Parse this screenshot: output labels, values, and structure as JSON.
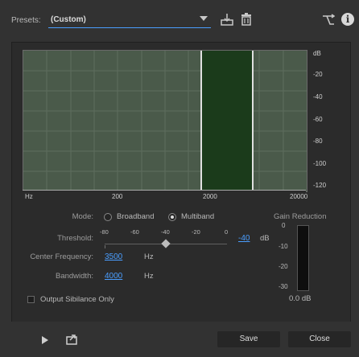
{
  "presets": {
    "label": "Presets:",
    "value": "(Custom)"
  },
  "graph": {
    "freq_ticks": [
      "Hz",
      "200",
      "2000",
      "20000"
    ],
    "db_ticks": [
      "dB",
      "-20",
      "-40",
      "-60",
      "-80",
      "-100",
      "-120"
    ]
  },
  "mode": {
    "label": "Mode:",
    "broadband": "Broadband",
    "multiband": "Multiband",
    "selected": "multiband"
  },
  "threshold": {
    "label": "Threshold:",
    "scale": [
      "-80",
      "-60",
      "-40",
      "-20",
      "0"
    ],
    "value": "-40",
    "unit": "dB"
  },
  "center_frequency": {
    "label": "Center Frequency:",
    "value": "3500",
    "unit": "Hz"
  },
  "bandwidth": {
    "label": "Bandwidth:",
    "value": "4000",
    "unit": "Hz"
  },
  "output_sibilance": {
    "label": "Output Sibilance Only",
    "checked": false
  },
  "gain_reduction": {
    "title": "Gain Reduction",
    "ticks": [
      "0",
      "-10",
      "-20",
      "-30"
    ],
    "value": "0.0 dB"
  },
  "buttons": {
    "save": "Save",
    "close": "Close"
  },
  "colors": {
    "accent": "#4a9eff",
    "band": "#1b3b1b",
    "graph_bg": "#4a5a4a"
  }
}
